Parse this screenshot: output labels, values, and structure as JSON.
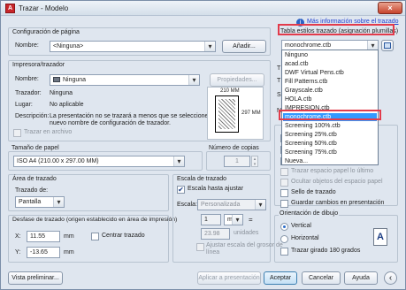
{
  "window": {
    "title": "Trazar - Modelo",
    "app_icon": "autocad-icon",
    "close": "×"
  },
  "header_link": "Más información sobre el trazado",
  "page_setup": {
    "group_label": "Configuración de página",
    "name_label": "Nombre:",
    "name_value": "<Ninguna>",
    "add_button": "Añadir..."
  },
  "plot_style": {
    "group_label": "Tabla estilos trazado (asignación plumillas)",
    "selected": "monochrome.ctb",
    "options": [
      "Ninguno",
      "acad.ctb",
      "DWF Virtual Pens.ctb",
      "Fill Patterns.ctb",
      "Grayscale.ctb",
      "HOLA.ctb",
      "IMPRESION.ctb",
      "monochrome.ctb",
      "Screening 100%.ctb",
      "Screening 25%.ctb",
      "Screening 50%.ctb",
      "Screening 75%.ctb",
      "Nueva..."
    ],
    "selected_index": 7
  },
  "printer": {
    "group_label": "Impresora/trazador",
    "name_label": "Nombre:",
    "name_value": "Ninguna",
    "properties_button": "Propiedades...",
    "plotter_label": "Trazador:",
    "plotter_value": "Ninguna",
    "where_label": "Lugar:",
    "where_value": "No aplicable",
    "desc_label": "Descripción:",
    "desc_value_1": "La presentación no se trazará a menos que se seleccione un",
    "desc_value_2": "nuevo nombre de configuración de trazador.",
    "to_file_label": "Trazar en archivo",
    "preview_width": "210 MM",
    "preview_height": "297 MM"
  },
  "paper_size": {
    "group_label": "Tamaño de papel",
    "value": "ISO A4 (210.00 x 297.00 MM)"
  },
  "copies": {
    "label": "Número de copias",
    "value": "1"
  },
  "plot_area": {
    "group_label": "Área de trazado",
    "what_label": "Trazado de:",
    "what_value": "Pantalla"
  },
  "plot_scale": {
    "group_label": "Escala de trazado",
    "fit_label": "Escala hasta ajustar",
    "fit_checked": "✔",
    "scale_label": "Escala:",
    "scale_value": "Personalizada",
    "value1": "1",
    "unit": "mm",
    "value2": "23.98",
    "unit2": "unidades",
    "lineweights_1": "Ajustar escala del grosor de",
    "lineweights_2": "línea"
  },
  "plot_offset": {
    "group_label": "Desfase de trazado (origen establecido en área de impresión)",
    "x_label": "X:",
    "x_value": "11.55",
    "x_unit": "mm",
    "center_label": "Centrar trazado",
    "y_label": "Y:",
    "y_value": "-13.65",
    "y_unit": "mm"
  },
  "right_options": {
    "plot_paperspace_last": "Trazar espacio papel lo último",
    "hide_paperspace": "Ocultar objetos del espacio papel",
    "plot_stamp": "Sello de trazado",
    "save_changes": "Guardar cambios en presentación"
  },
  "orientation": {
    "group_label": "Orientación de dibujo",
    "vertical": "Vertical",
    "horizontal": "Horizontal",
    "upside_down": "Trazar girado 180 grados",
    "icon_letter": "A"
  },
  "side_letters": [
    "T",
    "T",
    "S",
    "N"
  ],
  "footer": {
    "preview_button": "Vista preliminar...",
    "apply_button": "Aplicar a presentación",
    "ok_button": "Aceptar",
    "cancel_button": "Cancelar",
    "help_button": "Ayuda",
    "arrow": "‹"
  },
  "colors": {
    "accent": "#3399ff",
    "highlight": "#e23b4b",
    "link": "#1f3fd0"
  }
}
